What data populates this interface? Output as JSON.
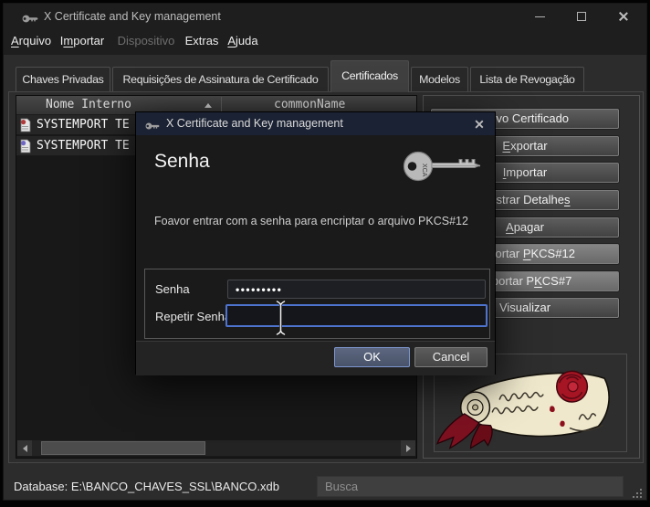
{
  "window": {
    "title": "X Certificate and Key management",
    "menu": [
      {
        "pre": "",
        "key": "A",
        "post": "rquivo"
      },
      {
        "pre": "I",
        "key": "m",
        "post": "portar"
      },
      {
        "pre": "Dispositivo",
        "key": "",
        "post": ""
      },
      {
        "pre": "Extras",
        "key": "",
        "post": ""
      },
      {
        "pre": "",
        "key": "A",
        "post": "juda"
      }
    ],
    "tabs": [
      {
        "label": "Chaves Privadas"
      },
      {
        "label": "Requisições de Assinatura de Certificado"
      },
      {
        "label": "Certificados"
      },
      {
        "label": "Modelos"
      },
      {
        "label": "Lista de Revogação"
      }
    ],
    "active_tab": "Certificados"
  },
  "table": {
    "columns": [
      "Nome Interno",
      "commonName"
    ],
    "rows": [
      {
        "name": "SYSTEMPORT TE",
        "icon": "certificate-red"
      },
      {
        "name": "SYSTEMPORT TE",
        "icon": "certificate-blue"
      }
    ]
  },
  "side_buttons": [
    {
      "pre": "Novo Certificado",
      "key": "",
      "post": ""
    },
    {
      "pre": "",
      "key": "E",
      "post": "xportar"
    },
    {
      "pre": "",
      "key": "I",
      "post": "mportar"
    },
    {
      "pre": "Mostrar Detalhe",
      "key": "s",
      "post": ""
    },
    {
      "pre": "",
      "key": "A",
      "post": "pagar"
    },
    {
      "pre": "Exportar ",
      "key": "P",
      "post": "KCS#12"
    },
    {
      "pre": "Exportar P",
      "key": "K",
      "post": "CS#7"
    },
    {
      "pre": "Visualizar",
      "key": "",
      "post": ""
    }
  ],
  "statusbar": {
    "database": "Database: E:\\BANCO_CHAVES_SSL\\BANCO.xdb",
    "search_placeholder": "Busca"
  },
  "dialog": {
    "title": "X Certificate and Key management",
    "heading": "Senha",
    "message": "Foavor entrar com a senha para encriptar o arquivo PKCS#12",
    "password_label": "Senha",
    "password_value": "•••••••••",
    "repeat_label": "Repetir Senha",
    "repeat_value": "",
    "ok_label": "OK",
    "cancel_label": "Cancel"
  },
  "colors": {
    "dialog-titlebar": "#1b2233",
    "focus-blue": "#4e73cf",
    "cert-red": "#b23a3a",
    "cert-blue": "#6f66c4",
    "ribbon-red": "#7d1120",
    "parchment": "#efe8cc"
  }
}
